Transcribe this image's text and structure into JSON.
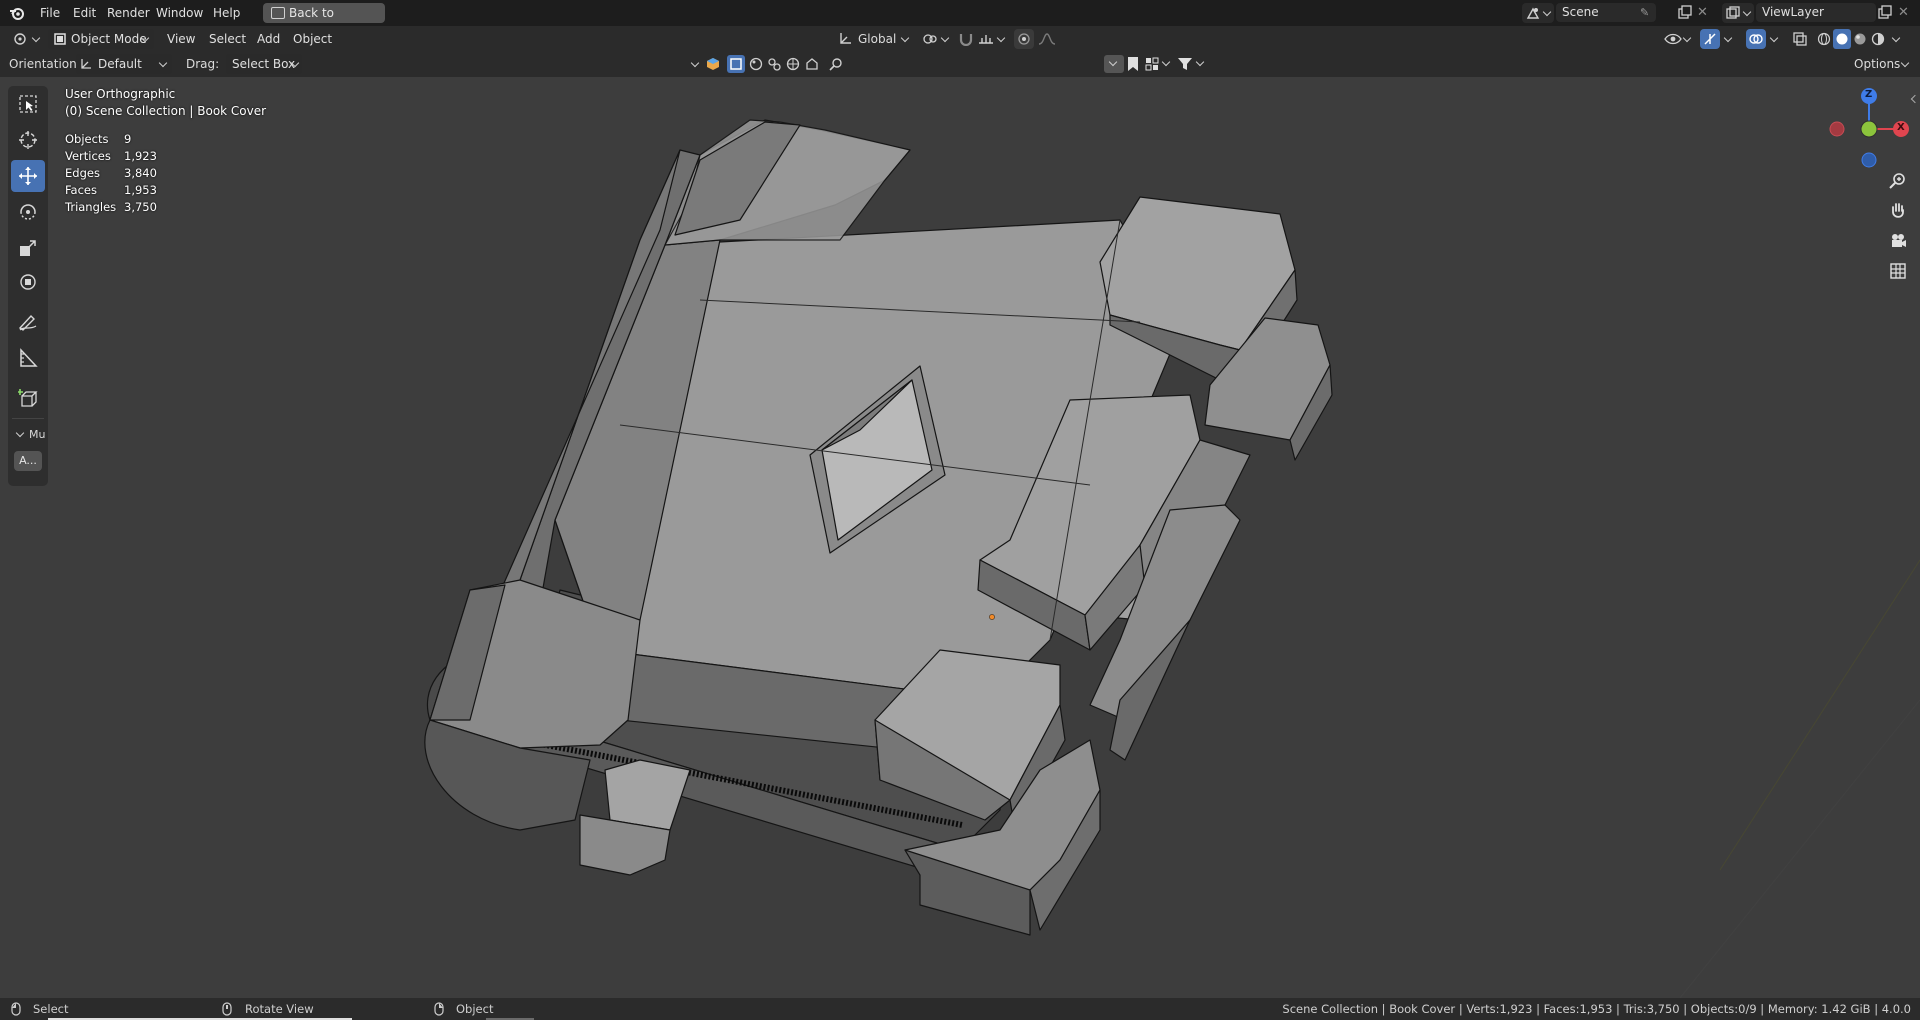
{
  "topbar": {
    "menus": [
      "File",
      "Edit",
      "Render",
      "Window",
      "Help"
    ],
    "back_button": "Back to Previous",
    "scene_name": "Scene",
    "view_layer": "ViewLayer"
  },
  "header": {
    "mode": "Object Mode",
    "menus": [
      "View",
      "Select",
      "Add",
      "Object"
    ],
    "transform_orientation": "Global"
  },
  "tool_settings": {
    "orientation_label": "Orientation:",
    "orientation_value": "Default",
    "drag_label": "Drag:",
    "drag_value": "Select Box",
    "options_label": "Options"
  },
  "viewport": {
    "view_name": "User Orthographic",
    "collection_line": "(0) Scene Collection | Book Cover",
    "stats": [
      {
        "label": "Objects",
        "value": "9"
      },
      {
        "label": "Vertices",
        "value": "1,923"
      },
      {
        "label": "Edges",
        "value": "3,840"
      },
      {
        "label": "Faces",
        "value": "1,953"
      },
      {
        "label": "Triangles",
        "value": "3,750"
      }
    ],
    "panel_label": "Mu",
    "panel_button": "A..."
  },
  "gizmo": {
    "z": "Z",
    "x": "X"
  },
  "statusbar": {
    "left_action": "Select",
    "middle_action": "Rotate View",
    "right_action": "Object",
    "info": "Scene Collection | Book Cover | Verts:1,923 | Faces:1,953 | Tris:3,750 | Objects:0/9 | Memory: 1.42 GiB | 4.0.0"
  },
  "colors": {
    "background": "#3d3d3d",
    "accent": "#4772b3",
    "x_axis": "#e0454f",
    "y_axis": "#8cc43c",
    "z_axis": "#3f7ce8"
  }
}
